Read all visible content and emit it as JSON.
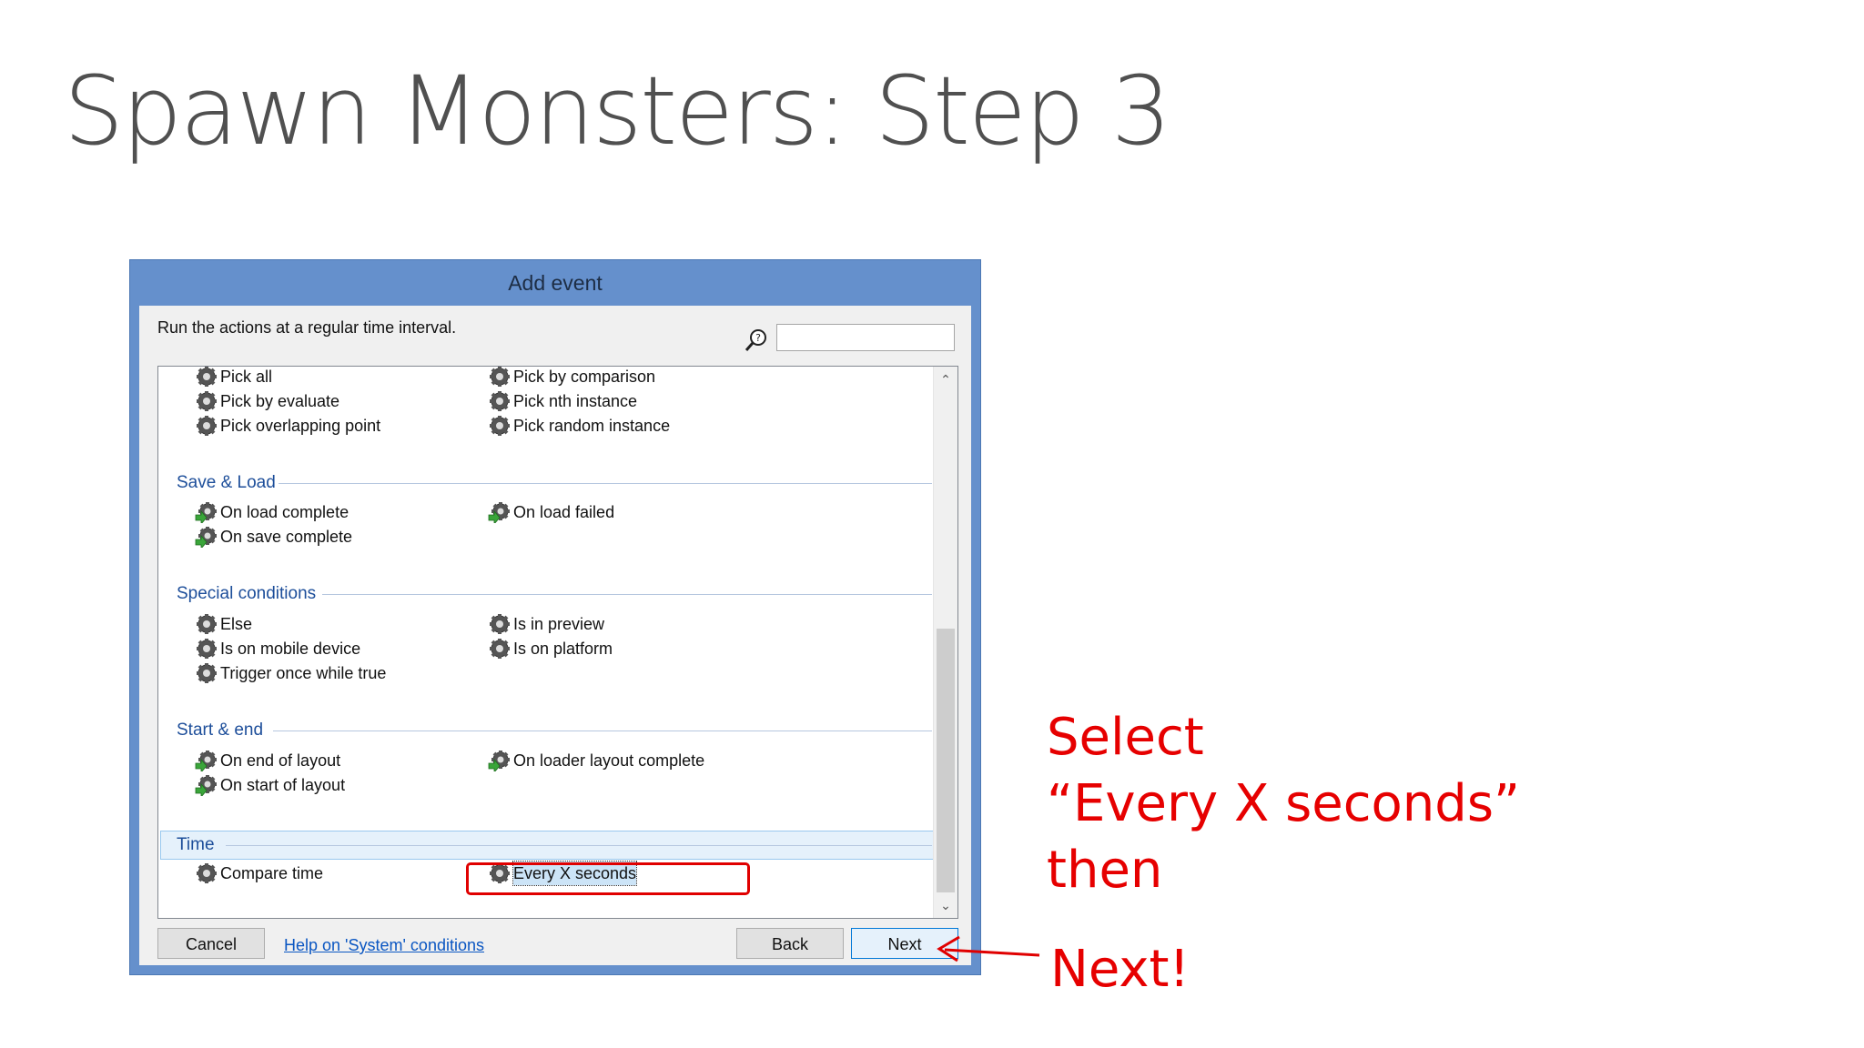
{
  "slide": {
    "title": "Spawn Monsters: Step 3"
  },
  "dialog": {
    "title": "Add event",
    "description": "Run the actions at a regular time interval.",
    "search": {
      "value": "",
      "placeholder": ""
    },
    "top_items": [
      "Pick all",
      "Pick by comparison",
      "Pick by evaluate",
      "Pick nth instance",
      "Pick overlapping point",
      "Pick random instance"
    ],
    "sections": {
      "save_load": {
        "label": "Save & Load",
        "items": [
          "On load complete",
          "On load failed",
          "On save complete"
        ]
      },
      "special": {
        "label": "Special conditions",
        "items": [
          "Else",
          "Is in preview",
          "Is on mobile device",
          "Is on platform",
          "Trigger once while true"
        ]
      },
      "start_end": {
        "label": "Start & end",
        "items": [
          "On end of layout",
          "On loader layout complete",
          "On start of layout"
        ]
      },
      "time": {
        "label": "Time",
        "items": [
          "Compare time",
          "Every X seconds"
        ]
      }
    },
    "buttons": {
      "cancel": "Cancel",
      "help": "Help on 'System' conditions",
      "back": "Back",
      "next": "Next"
    }
  },
  "annotation": {
    "line1": "Select",
    "line2": "“Every X seconds”",
    "line3": "then",
    "line4": "Next!",
    "color": "#e60000"
  }
}
